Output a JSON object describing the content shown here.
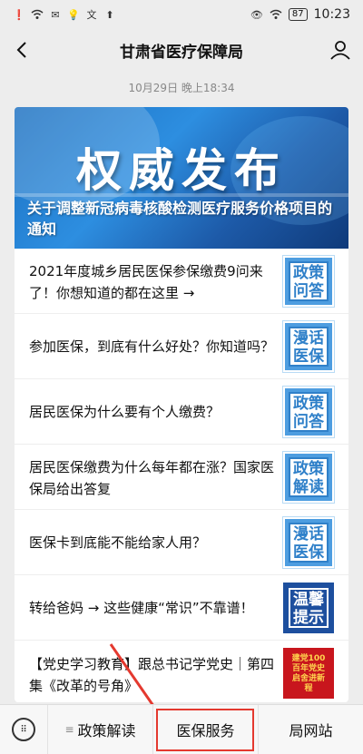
{
  "status_bar": {
    "battery": "87",
    "time": "10:23"
  },
  "header": {
    "title": "甘肃省医疗保障局"
  },
  "timestamp": "10月29日 晚上18:34",
  "banner": {
    "big_text": "权威发布",
    "headline": "关于调整新冠病毒核酸检测医疗服务价格项目的通知"
  },
  "articles": [
    {
      "title": "2021年度城乡居民医保参保缴费9问来了！你想知道的都在这里 →",
      "thumb": "政策问答",
      "thumb_style": "blue"
    },
    {
      "title": "参加医保，到底有什么好处？你知道吗？",
      "thumb": "漫话医保",
      "thumb_style": "blue"
    },
    {
      "title": "居民医保为什么要有个人缴费？",
      "thumb": "政策问答",
      "thumb_style": "blue"
    },
    {
      "title": "居民医保缴费为什么每年都在涨？国家医保局给出答复",
      "thumb": "政策解读",
      "thumb_style": "blue"
    },
    {
      "title": "医保卡到底能不能给家人用？",
      "thumb": "漫话医保",
      "thumb_style": "blue"
    },
    {
      "title": "转给爸妈 → 这些健康“常识”不靠谱！",
      "thumb": "温馨提示",
      "thumb_style": "dark"
    },
    {
      "title": "【党史学习教育】跟总书记学党史｜第四集《改革的号角》",
      "thumb": "建党100 百年党史 启舍进新程",
      "thumb_style": "red"
    }
  ],
  "bottom_nav": {
    "items": [
      "政策解读",
      "医保服务",
      "局网站"
    ]
  },
  "colors": {
    "highlight": "#e4392f",
    "banner_blue": "#1a6fc0"
  }
}
